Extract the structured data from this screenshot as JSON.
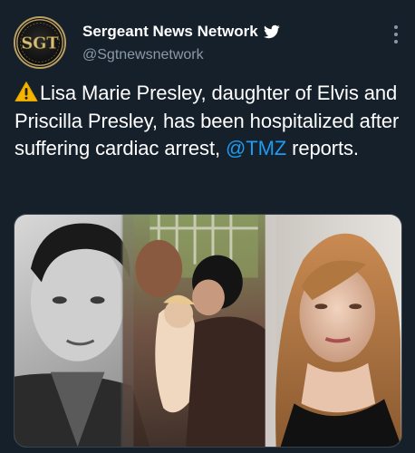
{
  "account": {
    "display_name": "Sergeant News Network",
    "handle": "@Sgtnewsnetwork",
    "avatar_text": "SGT",
    "verified_icon": "twitter-bird-icon"
  },
  "menu": {
    "icon": "more-vertical-icon"
  },
  "tweet": {
    "warning_icon": "warning-icon",
    "text_before_mention": "Lisa Marie Presley, daughter of Elvis and Priscilla Presley, has been hospitalized after suffering cardiac arrest, ",
    "mention": "@TMZ",
    "text_after_mention": " reports."
  },
  "media": {
    "image_name": "photo-collage"
  },
  "colors": {
    "background": "#15202b",
    "text": "#ffffff",
    "secondary_text": "#8b98a5",
    "link": "#1d9bf0",
    "avatar_gold": "#b9a062"
  }
}
